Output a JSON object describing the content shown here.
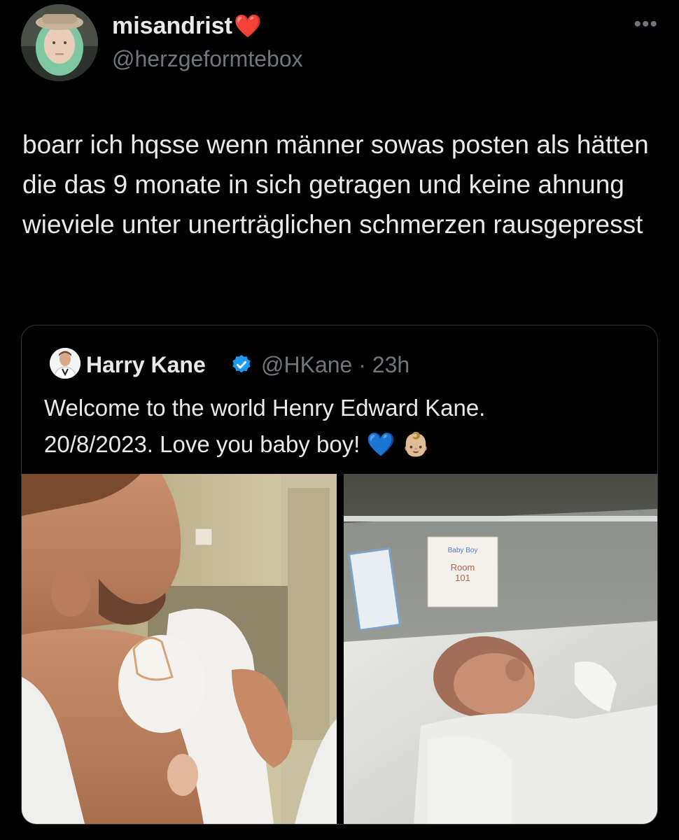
{
  "author": {
    "display_name": "misandrist",
    "name_emoji": "❤️",
    "handle": "@herzgeformtebox"
  },
  "menu": {
    "more_icon": "more-horizontal-icon",
    "more_glyph": "•••"
  },
  "tweet": {
    "text": "boarr ich hqsse wenn männer sowas posten als hätten die das 9 monate in sich getragen und keine ahnung wieviele unter unerträglichen schmerzen rausgepresst"
  },
  "quoted_tweet": {
    "display_name": "Harry Kane",
    "verified_icon": "verified-badge-icon",
    "handle_time": "@HKane · 23h",
    "text_line1": "Welcome to the world Henry Edward Kane.",
    "text_line2": "20/8/2023. Love you baby boy! ",
    "emoji_heart": "💙",
    "emoji_baby": "👶🏼",
    "photos": [
      {
        "label": "",
        "icon": "photo-man-holding-baby"
      },
      {
        "label": "",
        "icon": "photo-baby-in-bassinet"
      }
    ],
    "photo_sign_top": "Baby Boy",
    "photo_sign_room": "Room",
    "photo_sign_number": "101"
  },
  "colors": {
    "background": "#000000",
    "text_primary": "#e7e9ea",
    "text_secondary": "#71767b",
    "verified_blue": "#1d9bf0",
    "card_border": "#333639"
  }
}
